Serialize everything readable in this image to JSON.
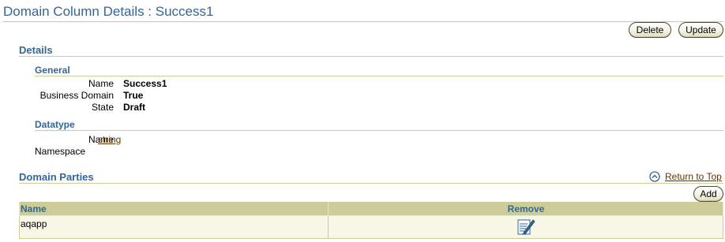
{
  "page": {
    "title": "Domain Column Details : Success1"
  },
  "actions": {
    "delete_label": "Delete",
    "update_label": "Update"
  },
  "details": {
    "heading": "Details",
    "general": {
      "heading": "General",
      "fields": [
        {
          "label": "Name",
          "value": "Success1"
        },
        {
          "label": "Business Domain",
          "value": "True"
        },
        {
          "label": "State",
          "value": "Draft"
        }
      ]
    },
    "datatype": {
      "heading": "Datatype",
      "fields": [
        {
          "label": "Name",
          "value": "string"
        },
        {
          "label": "Namespace",
          "value": ""
        }
      ]
    }
  },
  "domain_parties": {
    "heading": "Domain Parties",
    "return_to_top": "Return to Top",
    "return_icon": "return-to-top-icon",
    "add_label": "Add",
    "columns": [
      "Name",
      "Remove"
    ],
    "rows": [
      {
        "name": "aqapp",
        "remove_icon": "edit-pencil-icon"
      }
    ]
  },
  "colors": {
    "heading_blue": "#336699",
    "rule_tan": "#cccc99",
    "row_bg": "#f7f7e7",
    "link_brown": "#663300"
  }
}
